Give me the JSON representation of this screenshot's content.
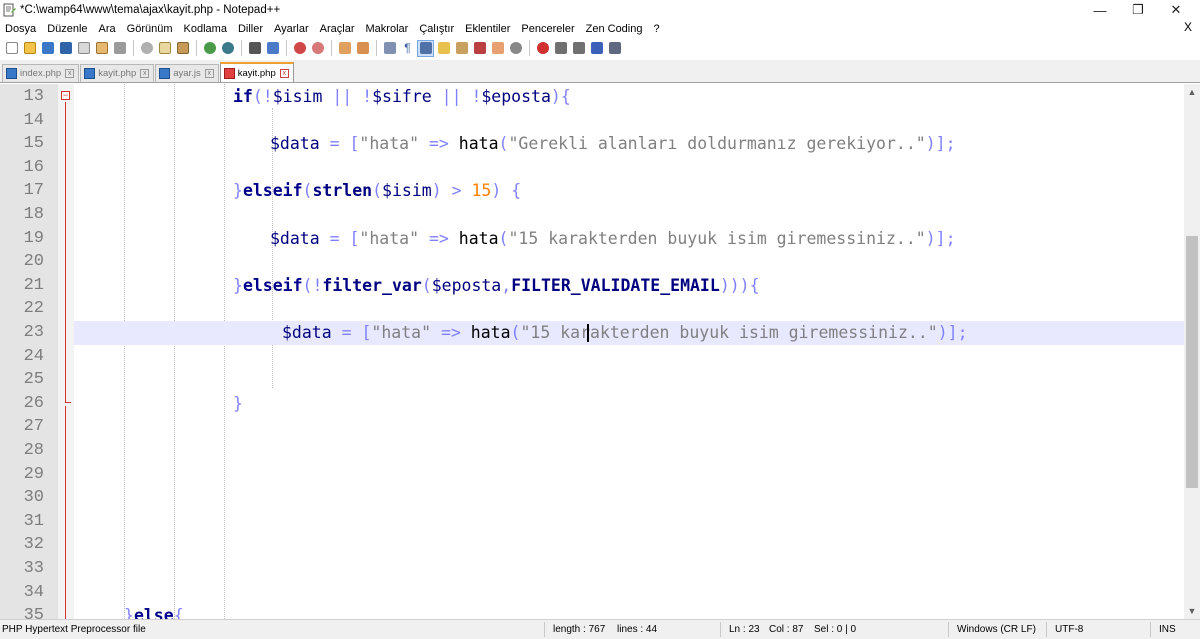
{
  "window": {
    "title": "*C:\\wamp64\\www\\tema\\ajax\\kayit.php - Notepad++",
    "minimize": "—",
    "maximize": "❐",
    "close": "✕"
  },
  "menu": [
    "Dosya",
    "Düzenle",
    "Ara",
    "Görünüm",
    "Kodlama",
    "Diller",
    "Ayarlar",
    "Araçlar",
    "Makrolar",
    "Çalıştır",
    "Eklentiler",
    "Pencereler",
    "Zen Coding",
    "?"
  ],
  "menu_close": "X",
  "tabs": [
    {
      "label": "index.php",
      "active": false
    },
    {
      "label": "kayit.php",
      "active": false
    },
    {
      "label": "ayar.js",
      "active": false
    },
    {
      "label": "kayit.php",
      "active": true
    }
  ],
  "editor": {
    "line_numbers": [
      "13",
      "14",
      "15",
      "16",
      "17",
      "18",
      "19",
      "20",
      "21",
      "22",
      "23",
      "24",
      "25",
      "26",
      "27",
      "28",
      "29",
      "30",
      "31",
      "32",
      "33",
      "34",
      "35"
    ],
    "current_line": "23",
    "lines": {
      "l13": [
        [
          "kw",
          "if"
        ],
        [
          "op",
          "(!"
        ],
        [
          "var",
          "$isim"
        ],
        [
          "op",
          " || !"
        ],
        [
          "var",
          "$sifre"
        ],
        [
          "op",
          " || !"
        ],
        [
          "var",
          "$eposta"
        ],
        [
          "op",
          "){"
        ]
      ],
      "l15": [
        [
          "var",
          "$data"
        ],
        [
          "op",
          " = ["
        ],
        [
          "str",
          "\"hata\""
        ],
        [
          "op",
          " => "
        ],
        [
          "fn",
          "hata"
        ],
        [
          "op",
          "("
        ],
        [
          "str",
          "\"Gerekli alanları doldurmanız gerekiyor..\""
        ],
        [
          "op",
          ")];"
        ]
      ],
      "l17": [
        [
          "op",
          "}"
        ],
        [
          "kw",
          "elseif"
        ],
        [
          "op",
          "("
        ],
        [
          "fnb",
          "strlen"
        ],
        [
          "op",
          "("
        ],
        [
          "var",
          "$isim"
        ],
        [
          "op",
          ") > "
        ],
        [
          "num",
          "15"
        ],
        [
          "op",
          ") {"
        ]
      ],
      "l19": [
        [
          "var",
          "$data"
        ],
        [
          "op",
          " = ["
        ],
        [
          "str",
          "\"hata\""
        ],
        [
          "op",
          " => "
        ],
        [
          "fn",
          "hata"
        ],
        [
          "op",
          "("
        ],
        [
          "str",
          "\"15 karakterden buyuk isim giremessiniz..\""
        ],
        [
          "op",
          ")];"
        ]
      ],
      "l21": [
        [
          "op",
          "}"
        ],
        [
          "kw",
          "elseif"
        ],
        [
          "op",
          "(!"
        ],
        [
          "fnb",
          "filter_var"
        ],
        [
          "op",
          "("
        ],
        [
          "var",
          "$eposta"
        ],
        [
          "op",
          ","
        ],
        [
          "fnb",
          "FILTER_VALIDATE_EMAIL"
        ],
        [
          "op",
          "))){"
        ]
      ],
      "l23": [
        [
          "var",
          "$data"
        ],
        [
          "op",
          " = ["
        ],
        [
          "str",
          "\"hata\""
        ],
        [
          "op",
          " => "
        ],
        [
          "fn",
          "hata"
        ],
        [
          "op",
          "("
        ],
        [
          "str",
          "\"15 karakterden buyuk isim giremessiniz..\""
        ],
        [
          "op",
          ")];"
        ]
      ],
      "l26": [
        [
          "op",
          "}"
        ]
      ],
      "l35": [
        [
          "op",
          "}"
        ],
        [
          "kw",
          "else"
        ],
        [
          "op",
          "{"
        ]
      ]
    }
  },
  "status": {
    "file_type": "PHP Hypertext Preprocessor file",
    "length": "length : 767",
    "lines": "lines : 44",
    "ln": "Ln : 23",
    "col": "Col : 87",
    "sel": "Sel : 0 | 0",
    "eol": "Windows (CR LF)",
    "encoding": "UTF-8",
    "mode": "INS"
  },
  "colors": {
    "keyword": "#00008b",
    "variable": "#000080",
    "operator": "#8080ff",
    "string": "#808080",
    "number": "#ff8000",
    "current_line": "#e8e8ff",
    "fold_marker": "#d43030"
  }
}
